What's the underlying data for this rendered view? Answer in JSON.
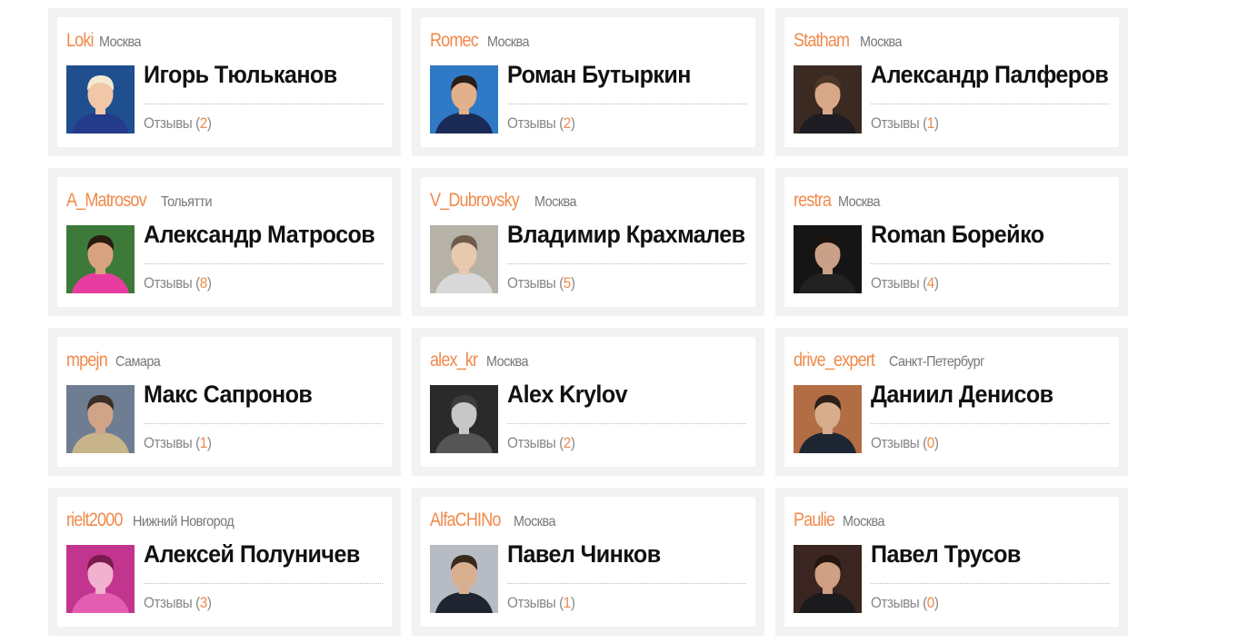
{
  "users": [
    {
      "login": "Loki",
      "city": "Москва",
      "name": "Игорь Тюльканов",
      "reviews_label": "Отзывы",
      "reviews_count": "2",
      "avatar": {
        "bg": "#1f4f8f",
        "skin": "#f0c8a8",
        "hair": "#f4ead2",
        "shirt": "#243a8a"
      }
    },
    {
      "login": "Romec",
      "city": "Москва",
      "name": "Роман Бутыркин",
      "reviews_label": "Отзывы",
      "reviews_count": "2",
      "avatar": {
        "bg": "#2f79c6",
        "skin": "#e2b08a",
        "hair": "#2a1f17",
        "shirt": "#1b2a55"
      }
    },
    {
      "login": "Statham",
      "city": "Москва",
      "name": "Александр Палферов",
      "reviews_label": "Отзывы",
      "reviews_count": "1",
      "avatar": {
        "bg": "#3a2a22",
        "skin": "#d8a888",
        "hair": "#4a3526",
        "shirt": "#1c1c22"
      }
    },
    {
      "login": "A_Matrosov",
      "city": "Тольятти",
      "name": "Александр Матросов",
      "reviews_label": "Отзывы",
      "reviews_count": "8",
      "avatar": {
        "bg": "#3d7a3a",
        "skin": "#d9a27e",
        "hair": "#2a1b12",
        "shirt": "#e73da0"
      }
    },
    {
      "login": "V_Dubrovsky",
      "city": "Москва",
      "name": "Владимир Крахмалев",
      "reviews_label": "Отзывы",
      "reviews_count": "5",
      "avatar": {
        "bg": "#b7b2a8",
        "skin": "#e8c9ad",
        "hair": "#6d5c4b",
        "shirt": "#d8d8d8"
      }
    },
    {
      "login": "restra",
      "city": "Москва",
      "name": "Roman Борейко",
      "reviews_label": "Отзывы",
      "reviews_count": "4",
      "avatar": {
        "bg": "#151515",
        "skin": "#caa088",
        "hair": "#1b1410",
        "shirt": "#222222"
      }
    },
    {
      "login": "mpejn",
      "city": "Самара",
      "name": "Макс Сапронов",
      "reviews_label": "Отзывы",
      "reviews_count": "1",
      "avatar": {
        "bg": "#6e7d92",
        "skin": "#d0a487",
        "hair": "#3a2e25",
        "shirt": "#c7b48a"
      }
    },
    {
      "login": "alex_kr",
      "city": "Москва",
      "name": "Alex Krylov",
      "reviews_label": "Отзывы",
      "reviews_count": "2",
      "avatar": {
        "bg": "#2a2a2a",
        "skin": "#c7c7c7",
        "hair": "#3d3d3d",
        "shirt": "#555555"
      }
    },
    {
      "login": "drive_expert",
      "city": "Санкт-Петербург",
      "name": "Даниил Денисов",
      "reviews_label": "Отзывы",
      "reviews_count": "0",
      "avatar": {
        "bg": "#b36d45",
        "skin": "#d8ad8e",
        "hair": "#2c2018",
        "shirt": "#1e2633"
      }
    },
    {
      "login": "rielt2000",
      "city": "Нижний Новгород",
      "name": "Алексей Полуничев",
      "reviews_label": "Отзывы",
      "reviews_count": "3",
      "avatar": {
        "bg": "#c2358f",
        "skin": "#f1b1cf",
        "hair": "#7a1a4e",
        "shirt": "#e35eb0"
      }
    },
    {
      "login": "AlfaCHINo",
      "city": "Москва",
      "name": "Павел Чинков",
      "reviews_label": "Отзывы",
      "reviews_count": "1",
      "avatar": {
        "bg": "#b7bcc4",
        "skin": "#d8b090",
        "hair": "#3a2a1e",
        "shirt": "#1f2430"
      }
    },
    {
      "login": "Paulie",
      "city": "Москва",
      "name": "Павел Трусов",
      "reviews_label": "Отзывы",
      "reviews_count": "0",
      "avatar": {
        "bg": "#3a2520",
        "skin": "#cfa083",
        "hair": "#23170f",
        "shirt": "#1b1b1d"
      }
    }
  ]
}
